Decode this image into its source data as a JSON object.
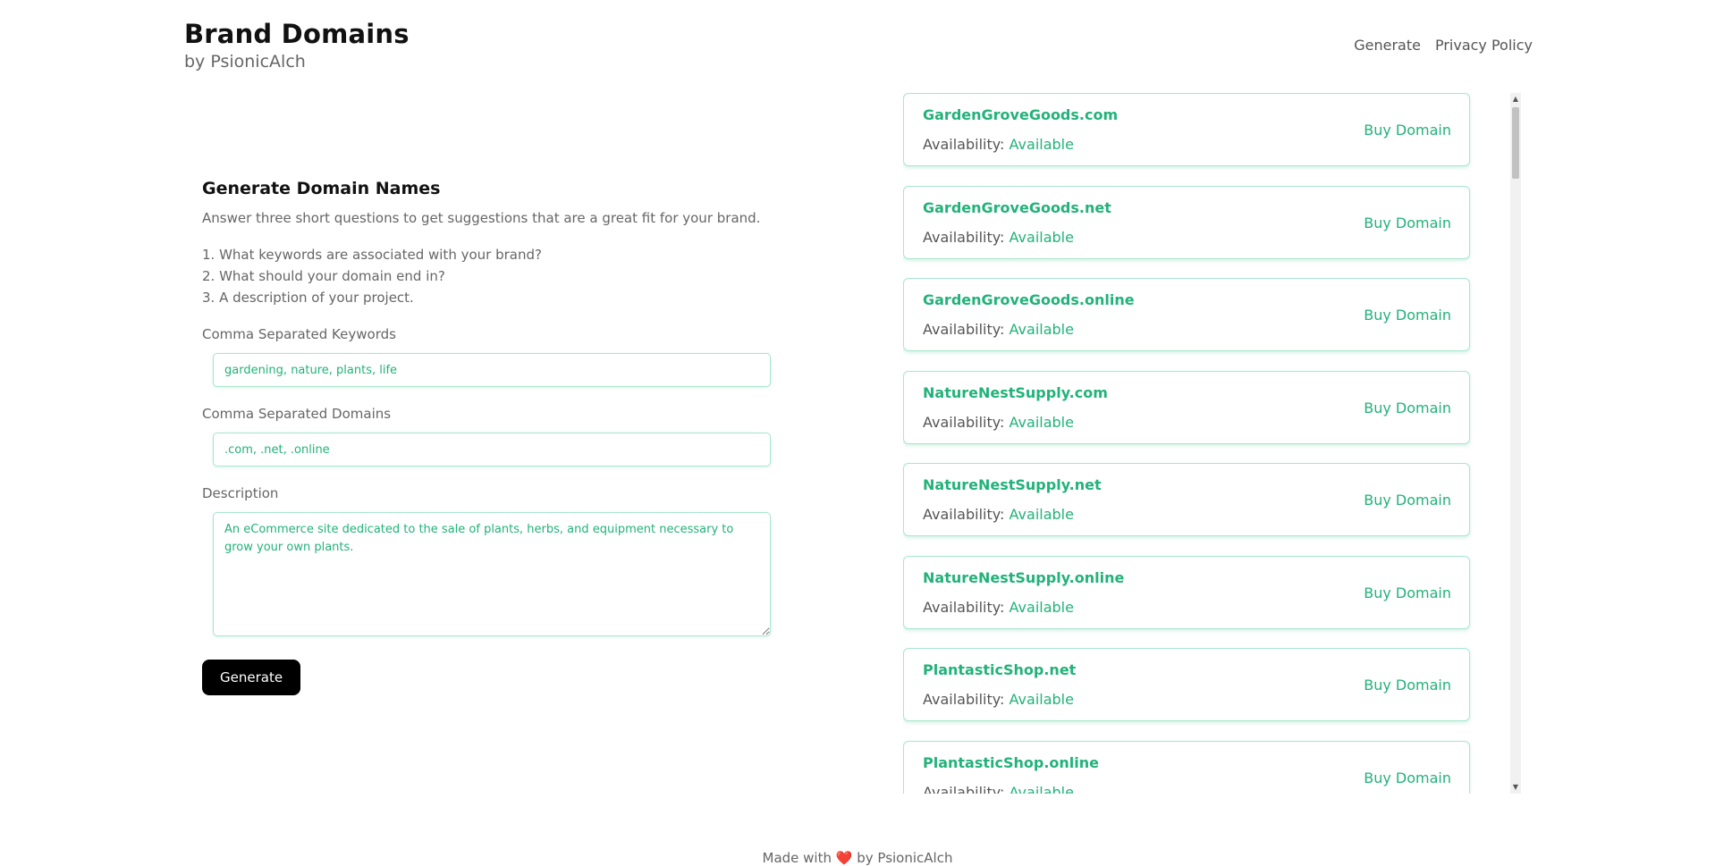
{
  "header": {
    "title": "Brand Domains",
    "subtitle": "by PsionicAlch"
  },
  "nav": [
    {
      "label": "Generate"
    },
    {
      "label": "Privacy Policy"
    }
  ],
  "form": {
    "title": "Generate Domain Names",
    "description": "Answer three short questions to get suggestions that are a great fit for your brand.",
    "steps": [
      "1. What keywords are associated with your brand?",
      "2. What should your domain end in?",
      "3. A description of your project."
    ],
    "keywords_label": "Comma Separated Keywords",
    "keywords_value": "gardening, nature, plants, life",
    "domains_label": "Comma Separated Domains",
    "domains_value": ".com, .net, .online",
    "description_label": "Description",
    "description_value": "An eCommerce site dedicated to the sale of plants, herbs, and equipment necessary to grow your own plants.",
    "generate_label": "Generate"
  },
  "results": [
    {
      "domain": "GardenGroveGoods.com",
      "availability_label": "Availability: ",
      "availability": "Available",
      "buy_label": "Buy Domain"
    },
    {
      "domain": "GardenGroveGoods.net",
      "availability_label": "Availability: ",
      "availability": "Available",
      "buy_label": "Buy Domain"
    },
    {
      "domain": "GardenGroveGoods.online",
      "availability_label": "Availability: ",
      "availability": "Available",
      "buy_label": "Buy Domain"
    },
    {
      "domain": "NatureNestSupply.com",
      "availability_label": "Availability: ",
      "availability": "Available",
      "buy_label": "Buy Domain"
    },
    {
      "domain": "NatureNestSupply.net",
      "availability_label": "Availability: ",
      "availability": "Available",
      "buy_label": "Buy Domain"
    },
    {
      "domain": "NatureNestSupply.online",
      "availability_label": "Availability: ",
      "availability": "Available",
      "buy_label": "Buy Domain"
    },
    {
      "domain": "PlantasticShop.net",
      "availability_label": "Availability: ",
      "availability": "Available",
      "buy_label": "Buy Domain"
    },
    {
      "domain": "PlantasticShop.online",
      "availability_label": "Availability: ",
      "availability": "Available",
      "buy_label": "Buy Domain"
    }
  ],
  "footer": {
    "prefix": "Made with",
    "heart": "❤️",
    "suffix": "by PsionicAlch"
  },
  "colors": {
    "accent": "#22b27a",
    "border": "#a8e6cf",
    "button": "#000000"
  }
}
